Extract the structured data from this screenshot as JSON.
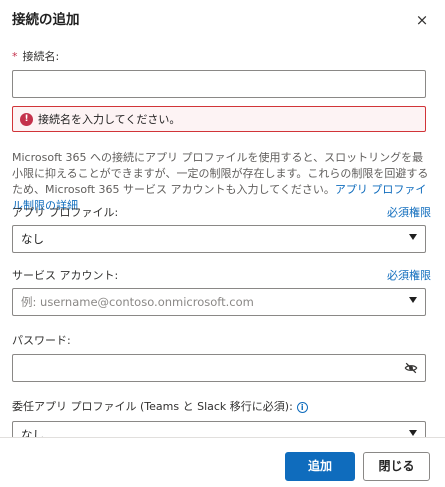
{
  "dialog": {
    "title": "接続の追加",
    "close_glyph": "×"
  },
  "connection_name": {
    "required_mark": "*",
    "label": "接続名:",
    "value": "",
    "error_icon": "!",
    "error_text": "接続名を入力してください。"
  },
  "info": {
    "text": "Microsoft 365 への接続にアプリ プロファイルを使用すると、スロットリングを最小限に抑えることができますが、一定の制限が存在します。これらの制限を回避するため、Microsoft 365 サービス アカウントも入力してください。",
    "link": "アプリ プロファイル制限の詳細"
  },
  "app_profile": {
    "label": "アプリ プロファイル:",
    "required_link": "必須権限",
    "value": "なし"
  },
  "service_account": {
    "label": "サービス アカウント:",
    "required_link": "必須権限",
    "placeholder": "例: username@contoso.onmicrosoft.com"
  },
  "password": {
    "label": "パスワード:",
    "value": ""
  },
  "delegated_profile": {
    "label": "委任アプリ プロファイル (Teams と Slack 移行に必須):",
    "info_glyph": "i",
    "value": "なし"
  },
  "footer": {
    "add_label": "追加",
    "close_label": "閉じる"
  },
  "icons": [
    "close-icon",
    "error-icon",
    "chevron-down-icon",
    "eye-off-icon",
    "info-icon"
  ],
  "colors": {
    "accent": "#0f6cbd",
    "error": "#c4314b",
    "error_bg": "#fdf3f4",
    "border": "#8a8886"
  }
}
